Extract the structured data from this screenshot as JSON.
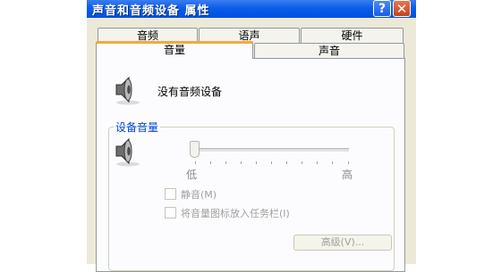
{
  "window": {
    "title": "声音和音频设备 属性",
    "help_label": "?",
    "close_label": "✕"
  },
  "tabs": {
    "row1": [
      "音频",
      "语声",
      "硬件"
    ],
    "row2": [
      "音量",
      "声音"
    ],
    "active": "音量"
  },
  "volume_tab": {
    "status_text": "没有音频设备",
    "group_label": "设备音量",
    "slider": {
      "low_label": "低",
      "high_label": "高",
      "level": 0
    },
    "mute_label": "静音(M)",
    "tray_icon_label": "将音量图标放入任务栏(I)",
    "advanced_button": "高级(V)..."
  },
  "icons": {
    "speaker": "speaker-icon"
  }
}
